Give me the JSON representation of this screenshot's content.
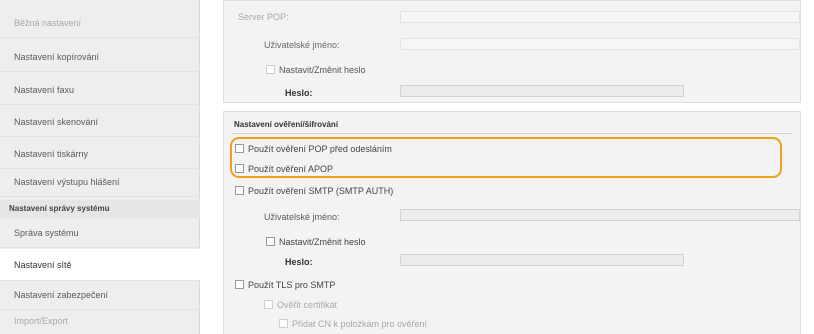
{
  "sidebar": {
    "items": [
      {
        "label": "Běžná nastavení",
        "state": "dim"
      },
      {
        "label": "Nastavení kopírování",
        "state": "normal"
      },
      {
        "label": "Nastavení faxu",
        "state": "normal"
      },
      {
        "label": "Nastavení skenování",
        "state": "normal"
      },
      {
        "label": "Nastavení tiskárny",
        "state": "normal"
      },
      {
        "label": "Nastavení výstupu hlášení",
        "state": "normal"
      }
    ],
    "section_header": "Nastavení správy systému",
    "sub_items": [
      {
        "label": "Správa systému",
        "state": "normal"
      },
      {
        "label": "Nastavení sítě",
        "state": "active"
      },
      {
        "label": "Nastavení zabezpečení",
        "state": "normal"
      },
      {
        "label": "Import/Export",
        "state": "dim"
      }
    ]
  },
  "pop_panel": {
    "server_label": "Server POP:",
    "username_label": "Uživatelské jméno:",
    "set_password_label": "Nastavit/Změnit heslo",
    "password_label": "Heslo:"
  },
  "auth_panel": {
    "title": "Nastavení ověření/šifrování",
    "pop_before_send": "Použít ověření POP před odesláním",
    "apop": "Použít ověření APOP",
    "smtp_auth": "Použít ověření SMTP (SMTP AUTH)",
    "username_label": "Uživatelské jméno:",
    "set_password_label": "Nastavit/Změnit heslo",
    "password_label": "Heslo:",
    "tls": "Použít TLS pro SMTP",
    "verify_cert": "Ověřit certifikát",
    "add_cn": "Přidat CN k položkám pro ověření"
  },
  "colors": {
    "highlight": "#f0a11c",
    "sidebar_bg": "#eeeeee",
    "panel_bg": "#f3f3f3"
  }
}
